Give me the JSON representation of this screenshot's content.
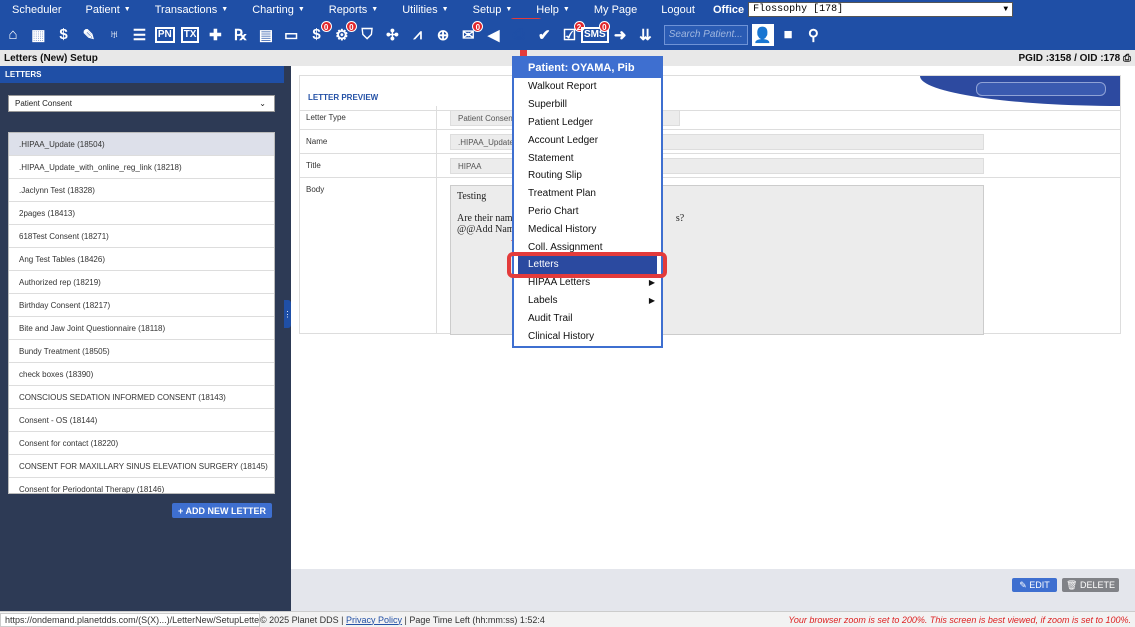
{
  "menubar": {
    "items": [
      {
        "label": "Scheduler",
        "caret": false
      },
      {
        "label": "Patient",
        "caret": true
      },
      {
        "label": "Transactions",
        "caret": true
      },
      {
        "label": "Charting",
        "caret": true
      },
      {
        "label": "Reports",
        "caret": true
      },
      {
        "label": "Utilities",
        "caret": true
      },
      {
        "label": "Setup",
        "caret": true
      },
      {
        "label": "Help",
        "caret": true
      },
      {
        "label": "My Page",
        "caret": false
      },
      {
        "label": "Logout",
        "caret": false
      }
    ],
    "office_label": "Office",
    "office_value": "Flossophy [178]"
  },
  "toolbar": {
    "search_placeholder": "Search Patient...",
    "icons": [
      {
        "name": "home-icon",
        "glyph": "⌂"
      },
      {
        "name": "calendar-icon",
        "glyph": "▦"
      },
      {
        "name": "dollar-icon",
        "glyph": "$"
      },
      {
        "name": "pencil-list-icon",
        "glyph": "✎"
      },
      {
        "name": "tooth-icon",
        "glyph": "♅"
      },
      {
        "name": "chart-list-icon",
        "glyph": "☰"
      },
      {
        "name": "pn-icon",
        "text": "PN"
      },
      {
        "name": "tx-icon",
        "text": "TX"
      },
      {
        "name": "add-user-icon",
        "glyph": "✚"
      },
      {
        "name": "rx-icon",
        "glyph": "℞"
      },
      {
        "name": "document-icon",
        "glyph": "▤"
      },
      {
        "name": "file-icon",
        "glyph": "▭"
      },
      {
        "name": "dollar-badge-icon",
        "glyph": "$",
        "badge": "0"
      },
      {
        "name": "settings-badge-icon",
        "glyph": "⚙",
        "badge": "0"
      },
      {
        "name": "shield-dollar-icon",
        "glyph": "⛉"
      },
      {
        "name": "network-icon",
        "glyph": "✣"
      },
      {
        "name": "line-chart-icon",
        "glyph": "⩘"
      },
      {
        "name": "globe-icon",
        "glyph": "⊕"
      },
      {
        "name": "message-badge-icon",
        "glyph": "✉",
        "badge": "0"
      },
      {
        "name": "megaphone-icon",
        "glyph": "◀"
      },
      {
        "name": "print-icon",
        "glyph": "⎙"
      },
      {
        "name": "verified-icon",
        "glyph": "✔"
      },
      {
        "name": "checklist-badge-icon",
        "glyph": "☑",
        "badge": "2"
      },
      {
        "name": "sms-badge-icon",
        "text": "SMS",
        "badge": "0"
      },
      {
        "name": "arrow-right-icon",
        "glyph": "➜"
      },
      {
        "name": "chevrons-down-icon",
        "glyph": "⇊"
      }
    ]
  },
  "subheader": {
    "title": "Letters (New) Setup",
    "ids": "PGID :3158  /  OID :178"
  },
  "left": {
    "title": "LETTERS",
    "category": "Patient Consent",
    "letters": [
      ".HIPAA_Update (18504)",
      ".HIPAA_Update_with_online_reg_link (18218)",
      ".Jaclynn Test (18328)",
      "2pages (18413)",
      "618Test Consent (18271)",
      "Ang Test Tables (18426)",
      "Authorized rep (18219)",
      "Birthday Consent (18217)",
      "Bite and Jaw Joint Questionnaire (18118)",
      "Bundy Treatment (18505)",
      "check boxes (18390)",
      "CONSCIOUS SEDATION INFORMED CONSENT (18143)",
      "Consent - OS (18144)",
      "Consent for contact (18220)",
      "CONSENT FOR MAXILLARY SINUS ELEVATION SURGERY (18145)",
      "Consent for Periodontal Therapy (18146)"
    ],
    "add_button": "+ ADD NEW LETTER"
  },
  "preview": {
    "title": "LETTER PREVIEW",
    "type_label": "Letter Type",
    "type_value": "Patient Consent",
    "name_label": "Name",
    "name_value": ".HIPAA_Update",
    "title_label": "Title",
    "title_value": "HIPAA",
    "body_label": "Body",
    "body_line1": "Testing",
    "body_line2": "Are their names",
    "body_line2_tail": "s?",
    "body_line3": "@@Add Names"
  },
  "actions": {
    "edit": "✎ EDIT",
    "delete": "🗑 DELETE"
  },
  "dropdown": {
    "header": "Patient: OYAMA, Pib",
    "items": [
      {
        "label": "Walkout Report",
        "sub": false
      },
      {
        "label": "Superbill",
        "sub": false
      },
      {
        "label": "Patient Ledger",
        "sub": false
      },
      {
        "label": "Account Ledger",
        "sub": false
      },
      {
        "label": "Statement",
        "sub": false
      },
      {
        "label": "Routing Slip",
        "sub": false
      },
      {
        "label": "Treatment Plan",
        "sub": false
      },
      {
        "label": "Perio Chart",
        "sub": false
      },
      {
        "label": "Medical History",
        "sub": false
      },
      {
        "label": "Coll. Assignment",
        "sub": false
      },
      {
        "label": "Letters",
        "sub": false,
        "active": true
      },
      {
        "label": "HIPAA Letters",
        "sub": true
      },
      {
        "label": "Labels",
        "sub": true
      },
      {
        "label": "Audit Trail",
        "sub": false
      },
      {
        "label": "Clinical History",
        "sub": false
      }
    ]
  },
  "status": {
    "url": "https://ondemand.planetdds.com/(S(X)...)/LetterNew/SetupLetter.aspx",
    "copyright": "© 2025 Planet DDS | ",
    "privacy": "Privacy Policy",
    "time_left": " | Page Time Left (hh:mm:ss) 1:52:4",
    "warning": "Your browser zoom is set to 200%. This screen is best viewed, if zoom is set to 100%."
  },
  "colors": {
    "brand": "#1f4fa6",
    "accent": "#3e6fd0",
    "highlight": "#e33b3b"
  }
}
